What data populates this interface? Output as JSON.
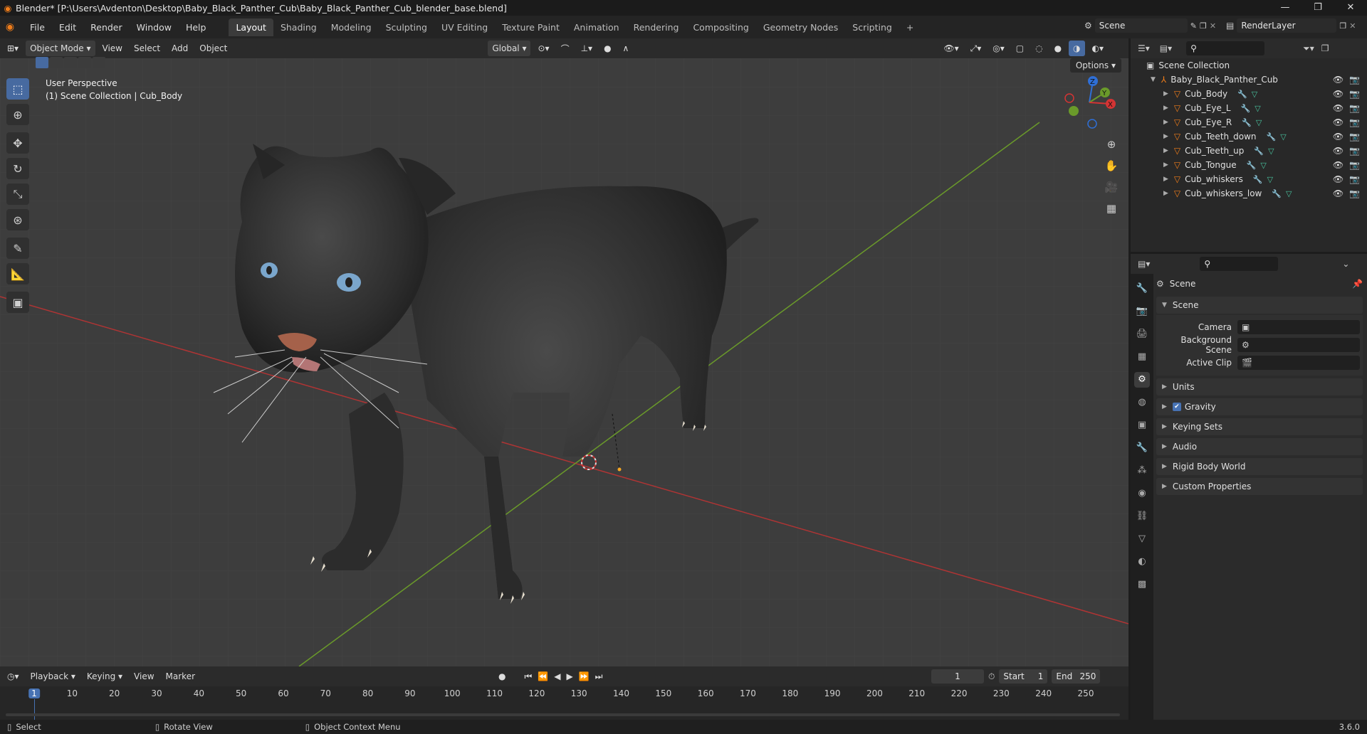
{
  "title_bar": {
    "title": "Blender* [P:\\Users\\Avdenton\\Desktop\\Baby_Black_Panther_Cub\\Baby_Black_Panther_Cub_blender_base.blend]",
    "minimize": "—",
    "maximize": "❐",
    "close": "✕"
  },
  "menu": [
    "File",
    "Edit",
    "Render",
    "Window",
    "Help"
  ],
  "workspaces": [
    "Layout",
    "Shading",
    "Modeling",
    "Sculpting",
    "UV Editing",
    "Texture Paint",
    "Animation",
    "Rendering",
    "Compositing",
    "Geometry Nodes",
    "Scripting",
    "+"
  ],
  "active_workspace": "Layout",
  "scene_field": "Scene",
  "renderlayer_field": "RenderLayer",
  "viewport_header": {
    "mode": "Object Mode",
    "view": "View",
    "select": "Select",
    "add": "Add",
    "object": "Object",
    "orientation": "Global",
    "options": "Options"
  },
  "viewport": {
    "perspective": "User Perspective",
    "collection": "(1) Scene Collection | Cub_Body"
  },
  "gizmo": {
    "z": "Z",
    "y": "Y",
    "x": "X"
  },
  "outliner": {
    "root": "Scene Collection",
    "collection": "Baby_Black_Panther_Cub",
    "items": [
      "Cub_Body",
      "Cub_Eye_L",
      "Cub_Eye_R",
      "Cub_Teeth_down",
      "Cub_Teeth_up",
      "Cub_Tongue",
      "Cub_whiskers",
      "Cub_whiskers_low"
    ]
  },
  "properties": {
    "context": "Scene",
    "section": "Scene",
    "camera_label": "Camera",
    "bgscene_label": "Background Scene",
    "clip_label": "Active Clip",
    "panels": [
      "Units",
      "Gravity",
      "Keying Sets",
      "Audio",
      "Rigid Body World",
      "Custom Properties"
    ]
  },
  "timeline": {
    "playback": "Playback",
    "keying": "Keying",
    "view": "View",
    "marker": "Marker",
    "current_frame": "1",
    "start_label": "Start",
    "start": "1",
    "end_label": "End",
    "end": "250",
    "ruler": [
      "1",
      "10",
      "20",
      "30",
      "40",
      "50",
      "60",
      "70",
      "80",
      "90",
      "100",
      "110",
      "120",
      "130",
      "140",
      "150",
      "160",
      "170",
      "180",
      "190",
      "200",
      "210",
      "220",
      "230",
      "240",
      "250"
    ]
  },
  "status": {
    "select": "Select",
    "rotate": "Rotate View",
    "context": "Object Context Menu",
    "version": "3.6.0"
  }
}
